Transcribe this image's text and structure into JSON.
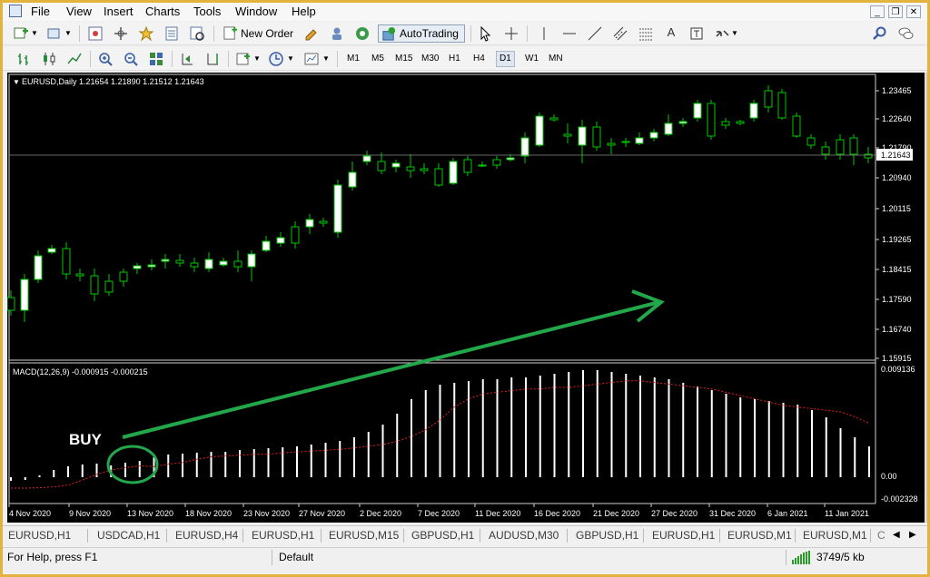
{
  "menu": [
    "File",
    "View",
    "Insert",
    "Charts",
    "Tools",
    "Window",
    "Help"
  ],
  "toolbar": {
    "new_order": "New Order",
    "autotrading": "AutoTrading"
  },
  "timeframes": [
    "M1",
    "M5",
    "M15",
    "M30",
    "H1",
    "H4",
    "D1",
    "W1",
    "MN"
  ],
  "active_timeframe": "D1",
  "chart": {
    "info": "EURUSD,Daily  1.21654 1.21890 1.21512 1.21643",
    "price_ticks": [
      "1.23465",
      "1.22640",
      "1.21790",
      "1.20940",
      "1.20115",
      "1.19265",
      "1.18415",
      "1.17590",
      "1.16740",
      "1.15915"
    ],
    "current_price": "1.21643",
    "macd_label": "MACD(12,26,9) -0.000915 -0.000215",
    "macd_ticks": [
      "0.009136",
      "0.00",
      "-0.002328"
    ],
    "date_ticks": [
      "4 Nov 2020",
      "9 Nov 2020",
      "13 Nov 2020",
      "18 Nov 2020",
      "23 Nov 2020",
      "27 Nov 2020",
      "2 Dec 2020",
      "7 Dec 2020",
      "11 Dec 2020",
      "16 Dec 2020",
      "21 Dec 2020",
      "27 Dec 2020",
      "31 Dec 2020",
      "6 Jan 2021",
      "11 Jan 2021"
    ],
    "annotation": "BUY",
    "colors": {
      "bg": "#000000",
      "up": "#ffffff",
      "down": "#000000",
      "wick": "#00c800",
      "signal": "#e02020",
      "arrow": "#22a84a"
    }
  },
  "tabs": [
    "EURUSD,H1",
    "USDCAD,H1",
    "EURUSD,H4",
    "EURUSD,H1",
    "EURUSD,M15",
    "GBPUSD,H1",
    "AUDUSD,M30",
    "GBPUSD,H1",
    "EURUSD,H1",
    "EURUSD,M1",
    "EURUSD,M1"
  ],
  "status": {
    "help": "For Help, press F1",
    "profile": "Default",
    "traffic": "3749/5 kb"
  }
}
